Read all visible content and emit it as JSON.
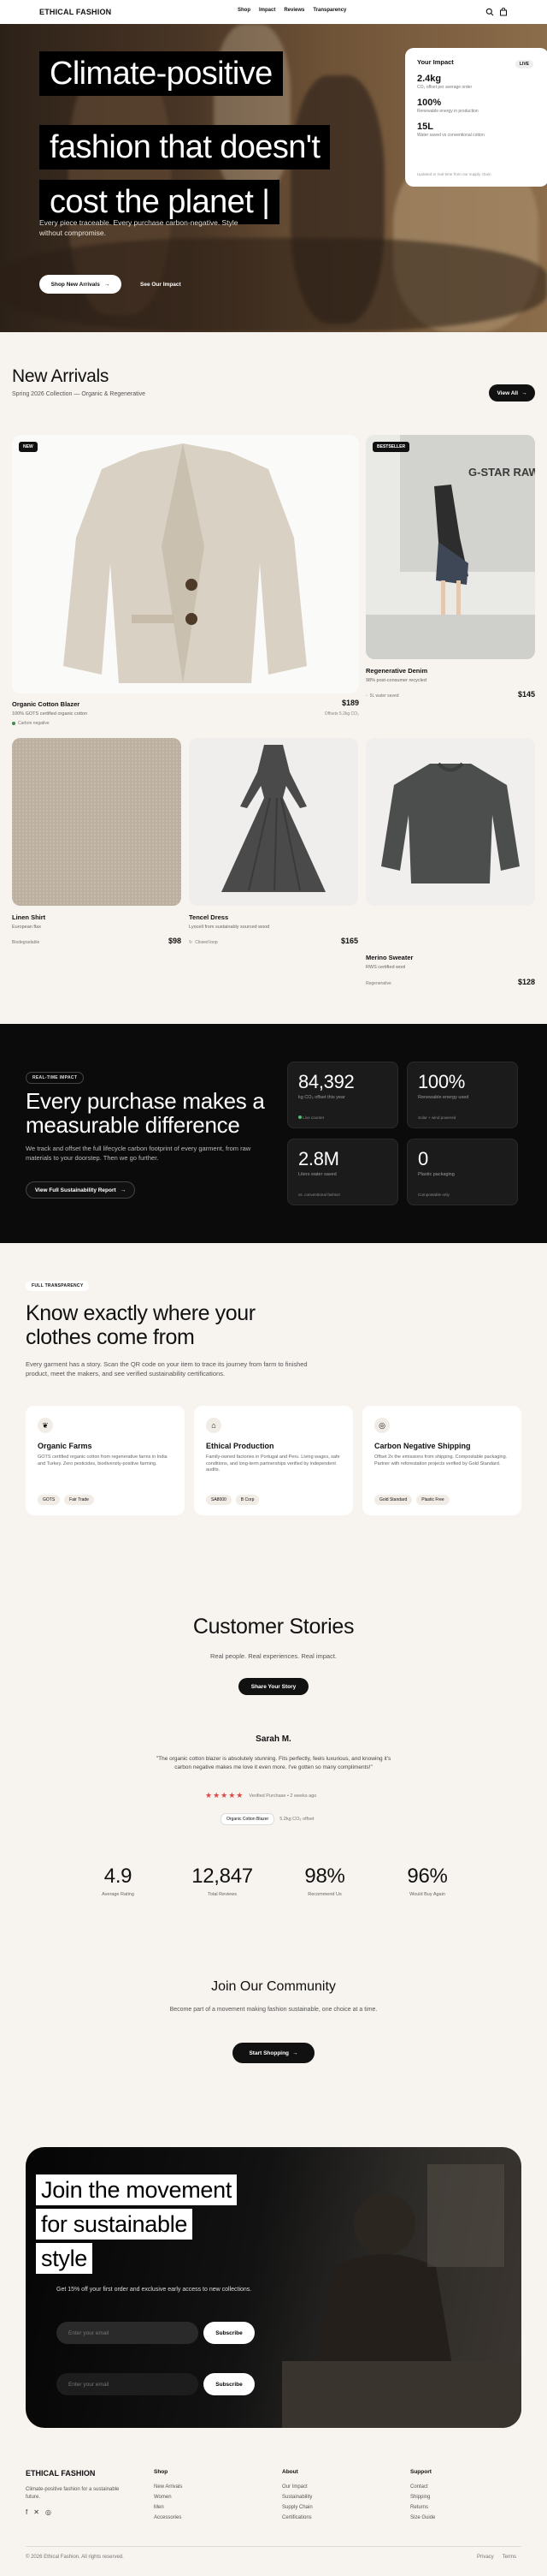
{
  "header": {
    "brand": "ETHICAL FASHION",
    "nav": [
      "Shop",
      "Impact",
      "Reviews",
      "Transparency"
    ],
    "icons": [
      "search-icon",
      "bag-icon"
    ]
  },
  "hero": {
    "headline": [
      "Climate-positive",
      "fashion that doesn't",
      "cost the planet |"
    ],
    "subtitle": "Every piece traceable. Every purchase carbon-negative. Style without compromise.",
    "cta_primary": "Shop New Arrivals",
    "cta_secondary": "See Our Impact",
    "impact_card": {
      "title": "Your Impact",
      "badge": "LIVE",
      "stats": [
        {
          "value": "2.4kg",
          "label": "CO₂ offset per average order"
        },
        {
          "value": "100%",
          "label": "Renewable energy in production"
        },
        {
          "value": "15L",
          "label": "Water saved vs conventional cotton"
        }
      ],
      "footer": "Updated in real-time from our supply chain"
    }
  },
  "arrivals": {
    "title": "New Arrivals",
    "subtitle": "Spring 2026 Collection — Organic & Regenerative",
    "view_all": "View All",
    "products": [
      {
        "badge": "NEW",
        "name": "Organic Cotton Blazer",
        "desc": "100% GOTS certified organic cotton",
        "tag": "Carbon negative",
        "price": "$189",
        "note": "Offsets 5.2kg CO₂"
      },
      {
        "badge": "BESTSELLER",
        "name": "Regenerative Denim",
        "desc": "98% post-consumer recycled",
        "tag": "5L water saved",
        "price": "$145"
      },
      {
        "name": "Linen Shirt",
        "desc": "European flax",
        "tag": "Biodegradable",
        "price": "$98"
      },
      {
        "name": "Tencel Dress",
        "desc": "Lyocell from sustainably sourced wood",
        "tag": "Closed loop",
        "price": "$165"
      },
      {
        "name": "Merino Sweater",
        "desc": "RWS certified wool",
        "tag": "Regenerative",
        "price": "$128"
      }
    ]
  },
  "impact": {
    "chip": "REAL-TIME IMPACT",
    "headline": [
      "Every purchase makes a",
      "measurable difference"
    ],
    "text": "We track and offset the full lifecycle carbon footprint of every garment, from raw materials to your doorstep. Then we go further.",
    "cta": "View Full Sustainability Report",
    "stats": [
      {
        "value": "84,392",
        "label": "kg CO₂ offset this year",
        "foot": "Live counter"
      },
      {
        "value": "100%",
        "label": "Renewable energy used",
        "foot": "Solar + wind powered"
      },
      {
        "value": "2.8M",
        "label": "Liters water saved",
        "foot": "vs. conventional fashion"
      },
      {
        "value": "0",
        "label": "Plastic packaging",
        "foot": "Compostable only"
      }
    ]
  },
  "transparency": {
    "chip": "FULL TRANSPARENCY",
    "headline": [
      "Know exactly where your",
      "clothes come from"
    ],
    "text": "Every garment has a story. Scan the QR code on your item to trace its journey from farm to finished product, meet the makers, and see verified sustainability certifications.",
    "features": [
      {
        "icon": "leaf-icon",
        "title": "Organic Farms",
        "desc": "GOTS certified organic cotton from regenerative farms in India and Turkey. Zero pesticides, biodiversity-positive farming.",
        "tags": [
          "GOTS",
          "Fair Trade"
        ]
      },
      {
        "icon": "factory-icon",
        "title": "Ethical Production",
        "desc": "Family-owned factories in Portugal and Peru. Living wages, safe conditions, and long-term partnerships verified by independent audits.",
        "tags": [
          "SA8000",
          "B Corp"
        ]
      },
      {
        "icon": "globe-icon",
        "title": "Carbon Negative Shipping",
        "desc": "Offset 2x the emissions from shipping. Compostable packaging. Partner with reforestation projects verified by Gold Standard.",
        "tags": [
          "Gold Standard",
          "Plastic Free"
        ]
      }
    ]
  },
  "stories": {
    "title": "Customer Stories",
    "subtitle": "Real people. Real experiences. Real impact.",
    "cta": "Share Your Story",
    "review": {
      "name": "Sarah M.",
      "quote": "\"The organic cotton blazer is absolutely stunning. Fits perfectly, feels luxurious, and knowing it's carbon negative makes me love it even more. I've gotten so many compliments!\"",
      "stars": "★★★★★",
      "meta": "Verified Purchase • 2 weeks ago",
      "product": "Organic Cotton Blazer",
      "offset": "5.2kg CO₂ offset"
    },
    "stats": [
      {
        "value": "4.9",
        "label": "Average Rating"
      },
      {
        "value": "12,847",
        "label": "Total Reviews"
      },
      {
        "value": "98%",
        "label": "Recommend Us"
      },
      {
        "value": "96%",
        "label": "Would Buy Again"
      }
    ]
  },
  "community": {
    "title": "Join Our Community",
    "text": "Become part of a movement making fashion sustainable, one choice at a time.",
    "cta": "Start Shopping"
  },
  "join": {
    "headline": [
      "Join the movement",
      "for sustainable",
      "style"
    ],
    "text": "Get 15% off your first order and exclusive early access to new collections.",
    "email_placeholder": "Enter your email",
    "button": "Subscribe"
  },
  "footer": {
    "brand": "ETHICAL FASHION",
    "tagline": "Climate-positive fashion for a sustainable future.",
    "social": [
      "facebook-icon",
      "twitter-icon",
      "instagram-icon"
    ],
    "columns": [
      {
        "title": "Shop",
        "links": [
          "New Arrivals",
          "Women",
          "Men",
          "Accessories"
        ]
      },
      {
        "title": "About",
        "links": [
          "Our Impact",
          "Sustainability",
          "Supply Chain",
          "Certifications"
        ]
      },
      {
        "title": "Support",
        "links": [
          "Contact",
          "Shipping",
          "Returns",
          "Size Guide"
        ]
      }
    ],
    "copyright": "© 2026 Ethical Fashion. All rights reserved.",
    "legal": [
      "Privacy",
      "Terms"
    ]
  }
}
